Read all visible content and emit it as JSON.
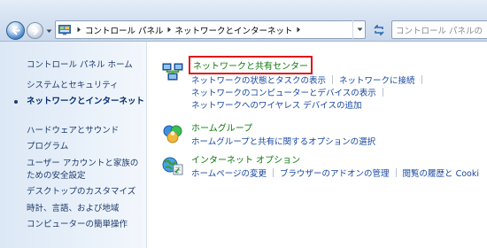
{
  "address_bar": {
    "breadcrumbs": [
      "コントロール パネル",
      "ネットワークとインターネット"
    ],
    "search_placeholder": "コントロール パネルの"
  },
  "left_pane": {
    "home": "コントロール パネル ホーム",
    "items": [
      {
        "label": "システムとセキュリティ",
        "current": false
      },
      {
        "label": "ネットワークとインターネット",
        "current": true
      },
      {
        "label": "ハードウェアとサウンド",
        "current": false
      },
      {
        "label": "プログラム",
        "current": false
      },
      {
        "label": "ユーザー アカウントと家族の",
        "current": false
      },
      {
        "label": "ための安全設定",
        "current": false
      },
      {
        "label": "デスクトップのカスタマイズ",
        "current": false
      },
      {
        "label": "時計、言語、および地域",
        "current": false
      },
      {
        "label": "コンピューターの簡単操作",
        "current": false
      }
    ]
  },
  "categories": [
    {
      "title": "ネットワークと共有センター",
      "icon": "network-share-center-icon",
      "rows": [
        [
          "ネットワークの状態とタスクの表示",
          "ネットワークに接続"
        ],
        [
          "ネットワークのコンピューターとデバイスの表示"
        ],
        [
          "ネットワークへのワイヤレス デバイスの追加"
        ]
      ]
    },
    {
      "title": "ホームグループ",
      "icon": "homegroup-icon",
      "rows": [
        [
          "ホームグループと共有に関するオプションの選択"
        ]
      ]
    },
    {
      "title": "インターネット オプション",
      "icon": "internet-options-icon",
      "rows": [
        [
          "ホームページの変更",
          "ブラウザーのアドオンの管理",
          "閲覧の履歴と Cooki"
        ]
      ]
    }
  ],
  "colors": {
    "category_title": "#0e7a0e",
    "link": "#1747a0",
    "highlight_box": "#e01818",
    "left_text": "#1e3b6e"
  }
}
